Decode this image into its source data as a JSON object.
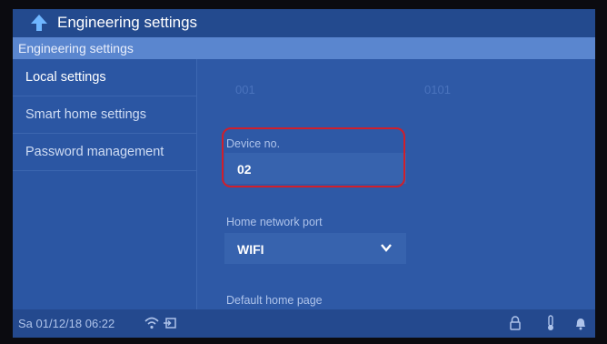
{
  "header": {
    "title": "Engineering settings",
    "subtitle": "Engineering settings"
  },
  "sidebar": {
    "items": [
      {
        "label": "Local settings",
        "active": true
      },
      {
        "label": "Smart home settings",
        "active": false
      },
      {
        "label": "Password management",
        "active": false
      }
    ]
  },
  "main": {
    "ghost_values": [
      "001",
      "0101"
    ],
    "device_no": {
      "label": "Device no.",
      "value": "02"
    },
    "network_port": {
      "label": "Home network port",
      "value": "WIFI"
    },
    "default_home": {
      "label": "Default home page"
    }
  },
  "status": {
    "datetime": "Sa 01/12/18  06:22",
    "icons": [
      "wifi-icon",
      "link-icon",
      "lock-icon",
      "thermometer-icon",
      "bell-icon"
    ]
  },
  "colors": {
    "background": "#2e59a6",
    "header": "#234a8e",
    "subheader": "#5a86cf",
    "highlight": "#d01f2b"
  }
}
